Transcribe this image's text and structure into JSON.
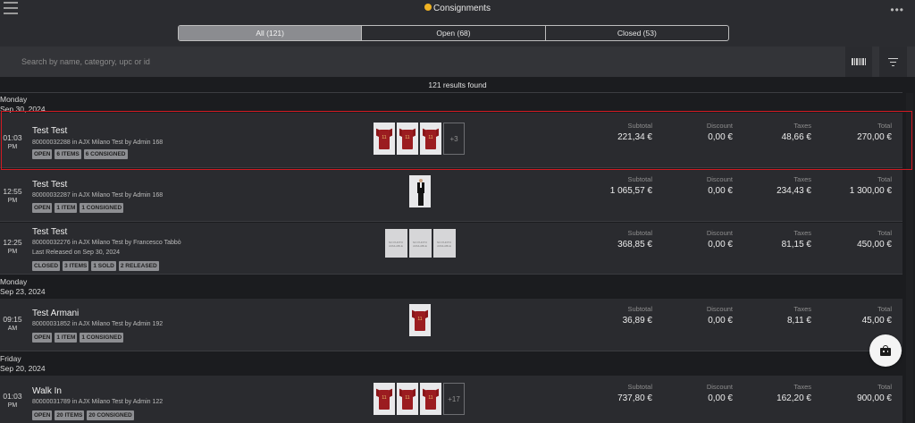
{
  "app": {
    "title": "Consignments",
    "menu_icon": "hamburger-menu-icon",
    "more_icon": "more-options-icon",
    "title_icon": "consignment-emoji-icon"
  },
  "tabs": [
    {
      "label": "All (121)",
      "active": true
    },
    {
      "label": "Open (68)",
      "active": false
    },
    {
      "label": "Closed (53)",
      "active": false
    }
  ],
  "search": {
    "placeholder": "Search by name, category, upc or id",
    "value": ""
  },
  "results_text": "121 results found",
  "days": [
    {
      "weekday": "Monday",
      "date": "Sep 30, 2024"
    },
    {
      "weekday": "Monday",
      "date": "Sep 23, 2024"
    },
    {
      "weekday": "Friday",
      "date": "Sep 20, 2024"
    }
  ],
  "amount_labels": {
    "subtotal": "Subtotal",
    "discount": "Discount",
    "taxes": "Taxes",
    "total": "Total"
  },
  "rows": [
    {
      "time": "01:03",
      "ampm": "PM",
      "name": "Test Test",
      "detail": "80000032288 in AJX Milano Test by Admin 168",
      "extra": "",
      "badges": [
        "OPEN",
        "6 ITEMS",
        "6 CONSIGNED"
      ],
      "thumb_more": "+3",
      "subtotal": "221,34 €",
      "discount": "0,00 €",
      "taxes": "48,66 €",
      "total": "270,00 €"
    },
    {
      "time": "12:55",
      "ampm": "PM",
      "name": "Test Test",
      "detail": "80000032287 in AJX Milano Test by Admin 168",
      "extra": "",
      "badges": [
        "OPEN",
        "1 ITEM",
        "1 CONSIGNED"
      ],
      "thumb_more": "",
      "subtotal": "1 065,57 €",
      "discount": "0,00 €",
      "taxes": "234,43 €",
      "total": "1 300,00 €"
    },
    {
      "time": "12:25",
      "ampm": "PM",
      "name": "Test Test",
      "detail": "80000032276 in AJX Milano Test by Francesco Tabbò",
      "extra": "Last Released on Sep 30, 2024",
      "badges": [
        "CLOSED",
        "3 ITEMS",
        "1 SOLD",
        "2 RELEASED"
      ],
      "thumb_more": "",
      "subtotal": "368,85 €",
      "discount": "0,00 €",
      "taxes": "81,15 €",
      "total": "450,00 €"
    },
    {
      "time": "09:15",
      "ampm": "AM",
      "name": "Test Armani",
      "detail": "80000031852 in AJX Milano Test by Admin 192",
      "extra": "",
      "badges": [
        "OPEN",
        "1 ITEM",
        "1 CONSIGNED"
      ],
      "thumb_more": "",
      "subtotal": "36,89 €",
      "discount": "0,00 €",
      "taxes": "8,11 €",
      "total": "45,00 €"
    },
    {
      "time": "01:03",
      "ampm": "PM",
      "name": "Walk In",
      "detail": "80000031789 in AJX Milano Test by Admin 122",
      "extra": "",
      "badges": [
        "OPEN",
        "20 ITEMS",
        "20 CONSIGNED"
      ],
      "thumb_more": "+17",
      "subtotal": "737,80 €",
      "discount": "0,00 €",
      "taxes": "162,20 €",
      "total": "900,00 €"
    }
  ],
  "placeholder_image_text": "NO PHOTO AVAILABLE",
  "fab_icon": "shopping-bag-icon",
  "colors": {
    "selection_border": "#d11a22",
    "shirt_red": "#9b1c20",
    "active_tab": "#8b8c90"
  }
}
